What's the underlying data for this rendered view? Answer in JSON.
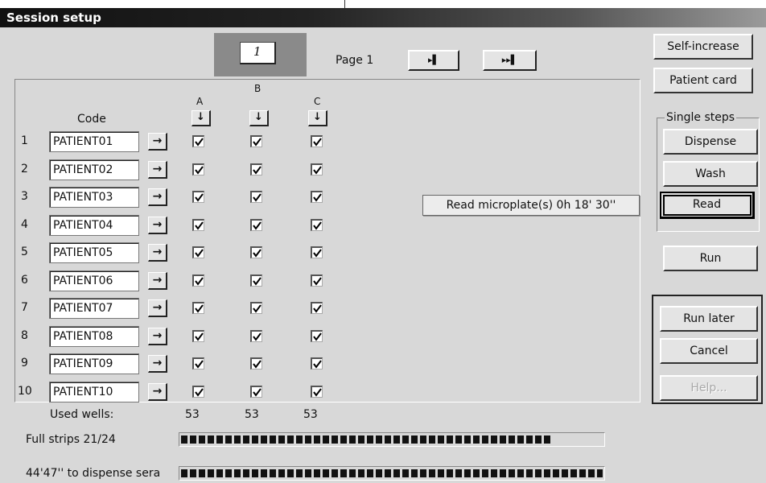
{
  "window": {
    "title": "Session setup"
  },
  "pager": {
    "page_label": "Page 1",
    "next_label": "▸▌",
    "last_label": "▸▸▌"
  },
  "columns": {
    "header_code": "Code",
    "names": [
      "A",
      "B",
      "C"
    ],
    "down_arrow": "↓"
  },
  "rows": [
    {
      "num": "1",
      "code": "PATIENT01"
    },
    {
      "num": "2",
      "code": "PATIENT02"
    },
    {
      "num": "3",
      "code": "PATIENT03"
    },
    {
      "num": "4",
      "code": "PATIENT04"
    },
    {
      "num": "5",
      "code": "PATIENT05"
    },
    {
      "num": "6",
      "code": "PATIENT06"
    },
    {
      "num": "7",
      "code": "PATIENT07"
    },
    {
      "num": "8",
      "code": "PATIENT08"
    },
    {
      "num": "9",
      "code": "PATIENT09"
    },
    {
      "num": "10",
      "code": "PATIENT10"
    }
  ],
  "row_arrow": "→",
  "checked": true,
  "used_wells": {
    "label": "Used wells:",
    "values": [
      "53",
      "53",
      "53"
    ]
  },
  "progress": [
    {
      "label": "Full strips 21/24",
      "fraction": 0.88
    },
    {
      "label": "44'47'' to dispense sera",
      "fraction": 1.0
    }
  ],
  "tooltip": {
    "text": "Read microplate(s)  0h 18' 30''"
  },
  "side": {
    "self_increase": "Self-increase",
    "patient_card": "Patient card",
    "single_steps": "Single steps",
    "dispense": "Dispense",
    "wash": "Wash",
    "read": "Read",
    "run": "Run",
    "run_later": "Run later",
    "cancel": "Cancel",
    "help": "Help..."
  }
}
